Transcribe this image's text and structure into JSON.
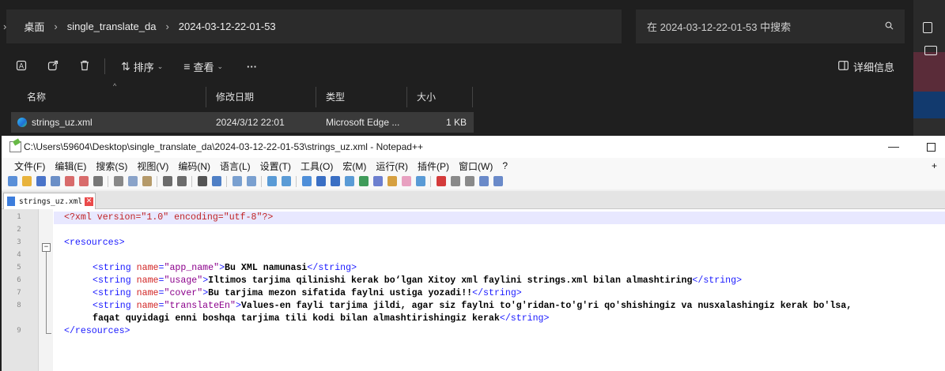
{
  "explorer": {
    "breadcrumb": [
      "桌面",
      "single_translate_da",
      "2024-03-12-22-01-53"
    ],
    "search_placeholder": "在 2024-03-12-22-01-53 中搜索",
    "toolbar": {
      "sort_label": "排序",
      "view_label": "查看",
      "more_label": "···",
      "details_label": "详细信息"
    },
    "columns": {
      "name": "名称",
      "modified": "修改日期",
      "type": "类型",
      "size": "大小"
    },
    "file": {
      "name": "strings_uz.xml",
      "modified": "2024/3/12 22:01",
      "type": "Microsoft Edge ...",
      "size": "1 KB"
    }
  },
  "notepad": {
    "title": "C:\\Users\\59604\\Desktop\\single_translate_da\\2024-03-12-22-01-53\\strings_uz.xml - Notepad++",
    "menu": [
      "文件(F)",
      "编辑(E)",
      "搜索(S)",
      "视图(V)",
      "编码(N)",
      "语言(L)",
      "设置(T)",
      "工具(O)",
      "宏(M)",
      "运行(R)",
      "插件(P)",
      "窗口(W)",
      "?"
    ],
    "plus": "+",
    "tab": "strings_uz.xml",
    "lines": [
      {
        "n": "1",
        "parts": [
          [
            "pi",
            "<?xml version=\"1.0\" encoding=\"utf-8\"?>"
          ]
        ]
      },
      {
        "n": "2",
        "parts": []
      },
      {
        "n": "3",
        "parts": [
          [
            "tag",
            "<resources>"
          ]
        ]
      },
      {
        "n": "4",
        "parts": []
      },
      {
        "n": "5",
        "parts": [
          [
            "sp",
            "    "
          ],
          [
            "tag",
            "<string "
          ],
          [
            "attr",
            "name"
          ],
          [
            "tag",
            "="
          ],
          [
            "val",
            "\"app_name\""
          ],
          [
            "tag",
            ">"
          ],
          [
            "txt",
            "Bu XML namunasi"
          ],
          [
            "tag",
            "</string>"
          ]
        ]
      },
      {
        "n": "6",
        "parts": [
          [
            "sp",
            "    "
          ],
          [
            "tag",
            "<string "
          ],
          [
            "attr",
            "name"
          ],
          [
            "tag",
            "="
          ],
          [
            "val",
            "\"usage\""
          ],
          [
            "tag",
            ">"
          ],
          [
            "txt",
            "Iltimos tarjima qilinishi kerak bo‘lgan Xitoy xml faylini strings.xml bilan almashtiring"
          ],
          [
            "tag",
            "</string>"
          ]
        ]
      },
      {
        "n": "7",
        "parts": [
          [
            "sp",
            "    "
          ],
          [
            "tag",
            "<string "
          ],
          [
            "attr",
            "name"
          ],
          [
            "tag",
            "="
          ],
          [
            "val",
            "\"cover\""
          ],
          [
            "tag",
            ">"
          ],
          [
            "txt",
            "Bu tarjima mezon sifatida faylni ustiga yozadi!!"
          ],
          [
            "tag",
            "</string>"
          ]
        ]
      },
      {
        "n": "8",
        "parts": [
          [
            "sp",
            "    "
          ],
          [
            "tag",
            "<string "
          ],
          [
            "attr",
            "name"
          ],
          [
            "tag",
            "="
          ],
          [
            "val",
            "\"translateEn\""
          ],
          [
            "tag",
            ">"
          ],
          [
            "txt",
            "Values-en fayli tarjima jildi, agar siz faylni to'g'ridan-to'g'ri qo'shishingiz va nusxalashingiz kerak bo'lsa,"
          ]
        ]
      },
      {
        "n": "",
        "parts": [
          [
            "sp",
            "    "
          ],
          [
            "txt",
            "faqat quyidagi enni boshqa tarjima tili kodi bilan almashtirishingiz kerak"
          ],
          [
            "tag",
            "</string>"
          ]
        ]
      },
      {
        "n": "9",
        "parts": [
          [
            "tag",
            "</resources>"
          ]
        ]
      }
    ]
  },
  "colors": {
    "explorer_bg": "#1f1f1f",
    "selected_row": "#3a3a3a",
    "xml_tag": "#1a1aff",
    "xml_attr": "#d12424",
    "xml_value": "#8b008b",
    "current_line": "#e8e8ff"
  }
}
